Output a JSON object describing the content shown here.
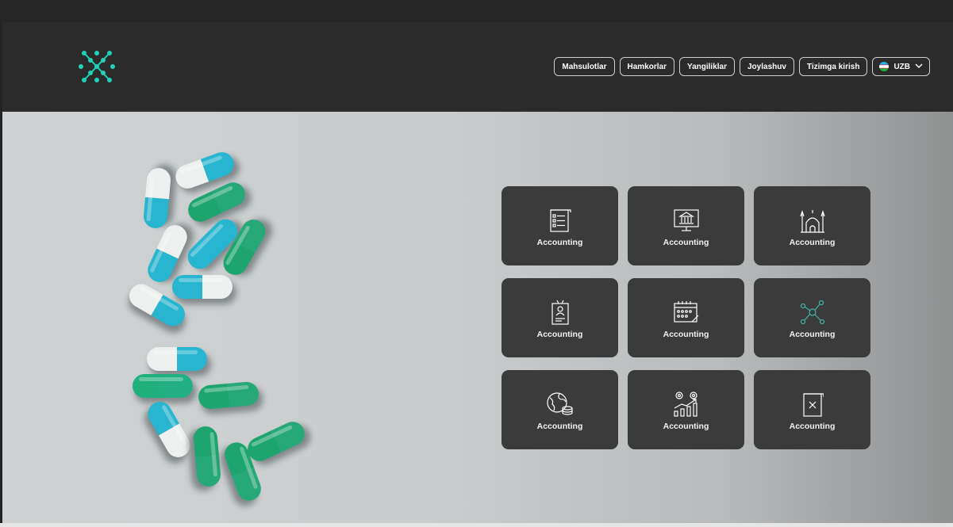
{
  "nav": {
    "items": [
      {
        "label": "Mahsulotlar"
      },
      {
        "label": "Hamkorlar"
      },
      {
        "label": "Yangiliklar"
      },
      {
        "label": "Joylashuv"
      },
      {
        "label": "Tizimga kirish"
      }
    ],
    "language": "UZB"
  },
  "colors": {
    "brand": "#1fd1b9",
    "header": "#2b2b2b",
    "card": "#3c3b3b"
  },
  "cards": [
    {
      "label": "Accounting",
      "icon": "checklist-icon"
    },
    {
      "label": "Accounting",
      "icon": "bank-monitor-icon"
    },
    {
      "label": "Accounting",
      "icon": "mosque-icon"
    },
    {
      "label": "Accounting",
      "icon": "id-badge-icon"
    },
    {
      "label": "Accounting",
      "icon": "calendar-icon"
    },
    {
      "label": "Accounting",
      "icon": "network-icon"
    },
    {
      "label": "Accounting",
      "icon": "globe-coins-icon"
    },
    {
      "label": "Accounting",
      "icon": "growth-chart-icon"
    },
    {
      "label": "Accounting",
      "icon": "document-x-icon"
    }
  ]
}
